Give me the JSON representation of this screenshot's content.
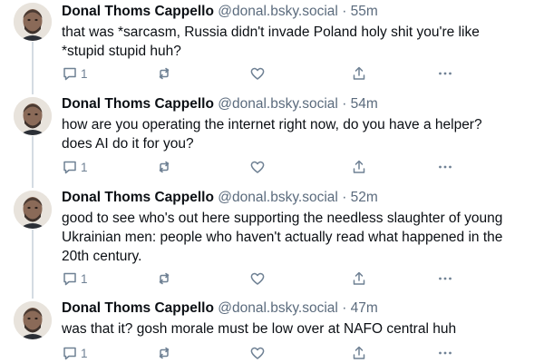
{
  "posts": [
    {
      "author": "Donal Thoms Cappello",
      "handle": "@donal.bsky.social",
      "separator": "·",
      "time": "55m",
      "lines": [
        "that was *sarcasm, Russia didn't invade Poland holy shit you're like",
        "*stupid stupid huh?"
      ],
      "reply_count": "1"
    },
    {
      "author": "Donal Thoms Cappello",
      "handle": "@donal.bsky.social",
      "separator": "·",
      "time": "54m",
      "lines": [
        "how are you operating the internet right now, do you have a helper?",
        "does AI do it for you?"
      ],
      "reply_count": "1"
    },
    {
      "author": "Donal Thoms Cappello",
      "handle": "@donal.bsky.social",
      "separator": "·",
      "time": "52m",
      "lines": [
        "good to see who's out here supporting the needless slaughter of young",
        "Ukrainian men: people who haven't actually read what happened in the",
        "20th century."
      ],
      "reply_count": "1"
    },
    {
      "author": "Donal Thoms Cappello",
      "handle": "@donal.bsky.social",
      "separator": "·",
      "time": "47m",
      "lines": [
        "was that it? gosh morale must be low over at NAFO central huh"
      ],
      "reply_count": "1"
    }
  ],
  "icons": {
    "reply": "reply-icon",
    "repost": "repost-icon",
    "like": "heart-icon",
    "share": "share-icon",
    "more": "more-options-icon"
  },
  "colors": {
    "text": "#0b0f14",
    "muted": "#5b6b7d",
    "icon": "#6f8194",
    "thread_line": "#d4dbe2"
  }
}
